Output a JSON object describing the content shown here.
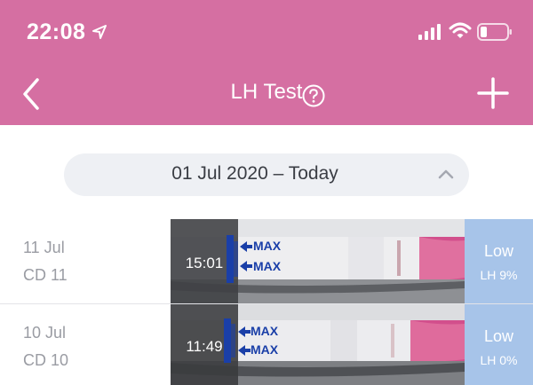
{
  "status_bar": {
    "time": "22:08"
  },
  "nav": {
    "title": "LH Test"
  },
  "filter": {
    "date_range": "01 Jul 2020 – Today"
  },
  "tests": [
    {
      "date": "11 Jul",
      "cycle_day": "CD 11",
      "time": "15:01",
      "level": "Low",
      "lh_percent": "LH 9%",
      "max_label": "MAX"
    },
    {
      "date": "10 Jul",
      "cycle_day": "CD 10",
      "time": "11:49",
      "level": "Low",
      "lh_percent": "LH 0%",
      "max_label": "MAX"
    }
  ],
  "colors": {
    "header": "#d56fa2",
    "result_bg": "#a7c4e9",
    "pill_bg": "#eef0f4"
  }
}
